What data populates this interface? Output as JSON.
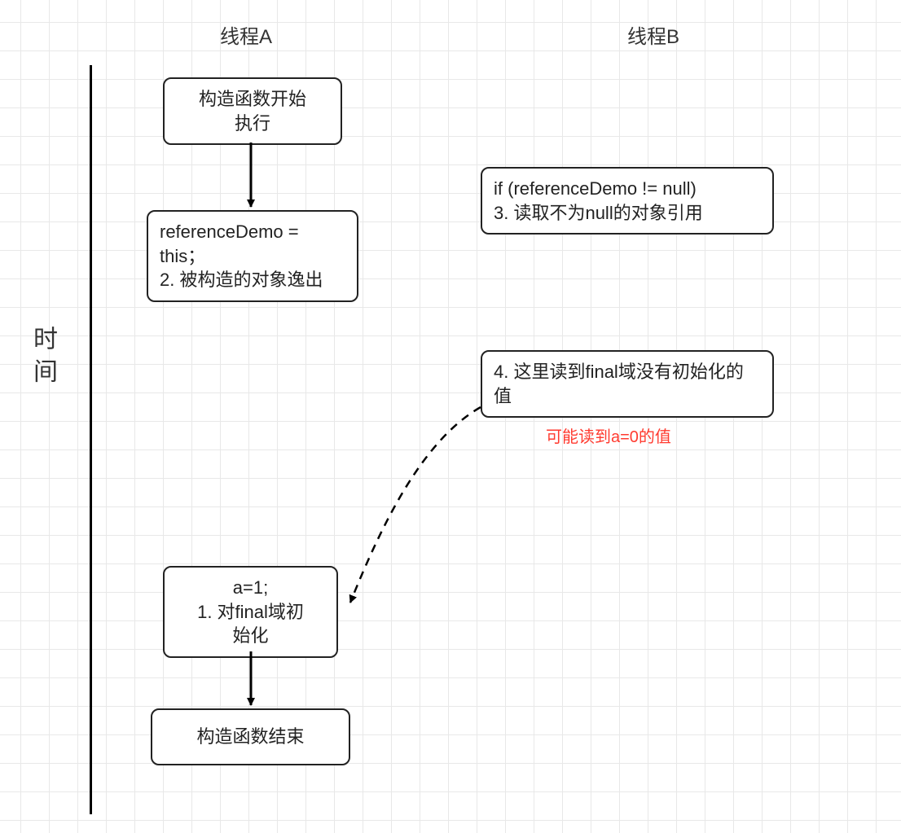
{
  "headers": {
    "threadA": "线程A",
    "threadB": "线程B"
  },
  "timeLabel": "时间",
  "boxes": {
    "constructorStart": "构造函数开始\n执行",
    "assignThis": "referenceDemo = this；\n2. 被构造的对象逸出",
    "ifCheck": " if (referenceDemo != null)\n3. 读取不为null的对象引用",
    "readFinal": "4. 这里读到final域没有初始化的值",
    "initA": "a=1;\n1. 对final域初\n始化",
    "constructorEnd": "构造函数结束"
  },
  "note": "可能读到a=0的值"
}
